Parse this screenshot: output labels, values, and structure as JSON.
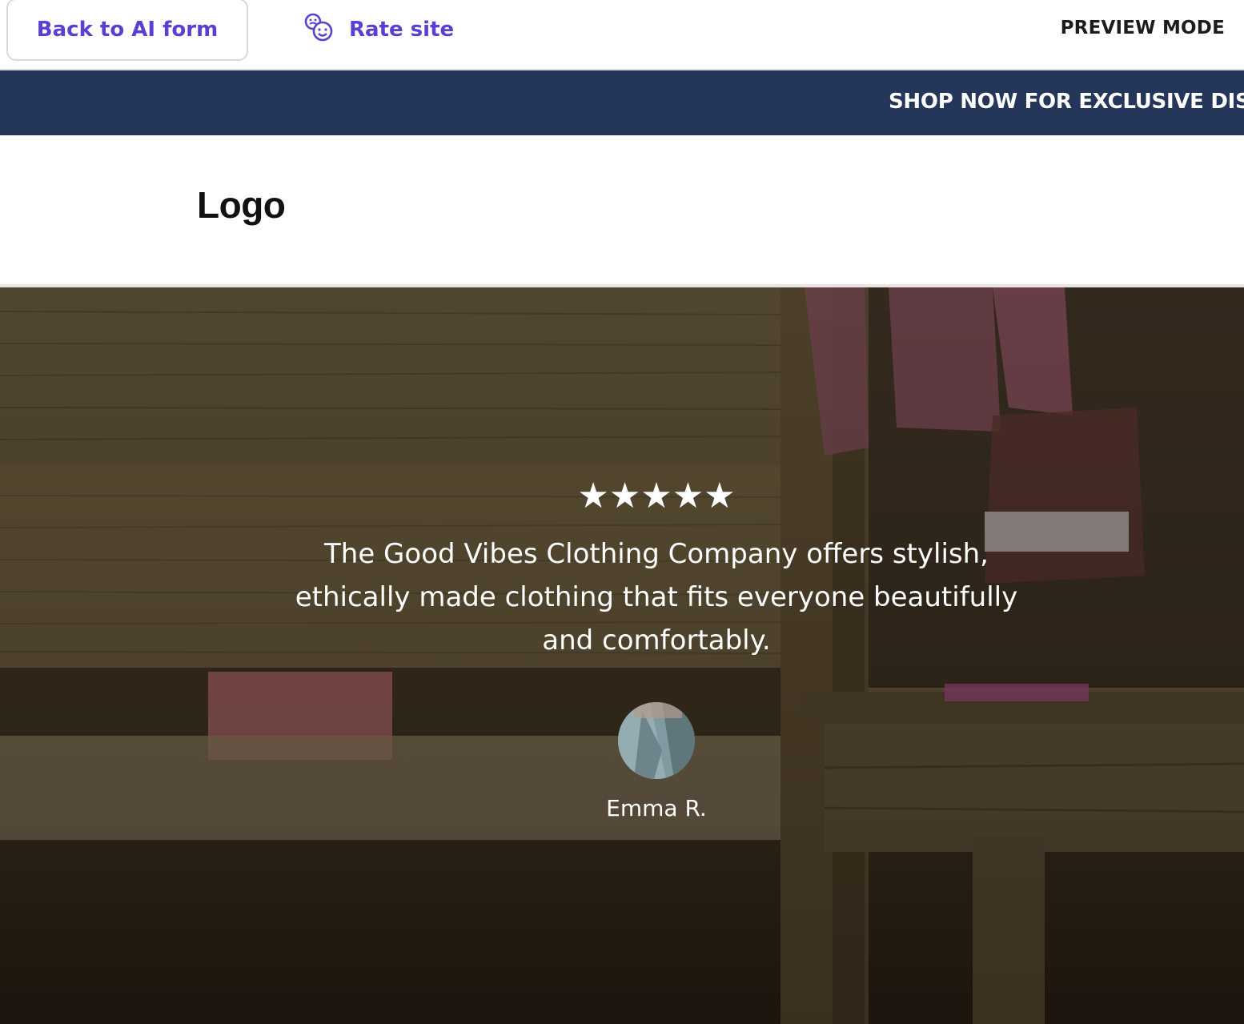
{
  "topbar": {
    "back_label": "Back to AI form",
    "rate_label": "Rate site",
    "mode_label": "PREVIEW MODE"
  },
  "announcement": {
    "text": "SHOP NOW FOR EXCLUSIVE DISC"
  },
  "header": {
    "logo_text": "Logo"
  },
  "testimonial": {
    "stars": "★★★★★",
    "rating": 5,
    "quote": "The Good Vibes Clothing Company offers stylish, ethically made clothing that fits everyone beautifully and comfortably.",
    "reviewer": "Emma R."
  },
  "colors": {
    "accent": "#5b3fd0",
    "announcement_bg": "#243659"
  },
  "icons": {
    "rate": "smiley-faces-icon"
  }
}
